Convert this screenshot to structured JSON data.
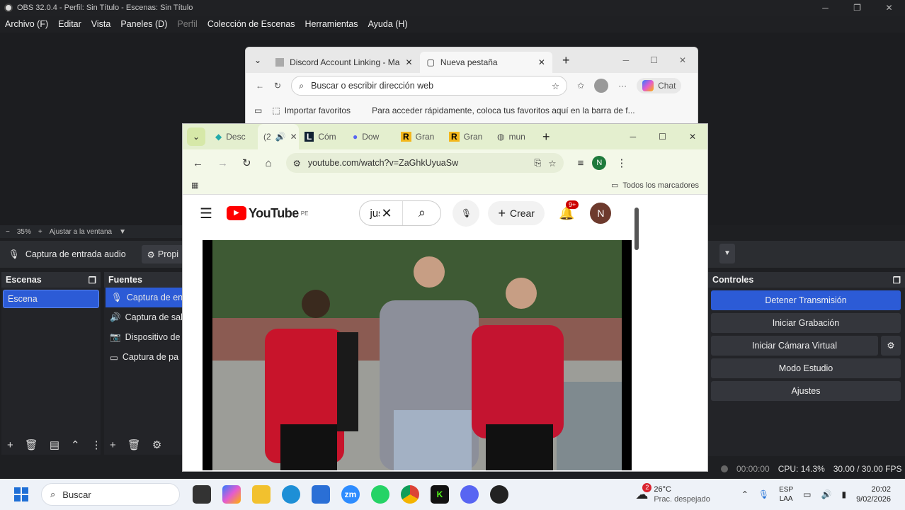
{
  "obs": {
    "title": "OBS 32.0.4 - Perfil: Sin Título - Escenas: Sin Título",
    "menu": [
      "Archivo (F)",
      "Editar",
      "Vista",
      "Paneles (D)",
      "Perfil",
      "Colección de Escenas",
      "Herramientas",
      "Ayuda (H)"
    ],
    "zoom": "35%",
    "fit_window": "Ajustar a la ventana",
    "source_toolbar_label": "Captura de entrada audio",
    "properties_label": "Propi",
    "scenes_title": "Escenas",
    "scenes": [
      "Escena"
    ],
    "sources_title": "Fuentes",
    "sources": [
      "Captura de ent",
      "Captura de sal",
      "Dispositivo de",
      "Captura de pa"
    ],
    "controls_title": "Controles",
    "controls": {
      "stop_stream": "Detener Transmisión",
      "start_record": "Iniciar Grabación",
      "virtual_cam": "Iniciar Cámara Virtual",
      "studio_mode": "Modo Estudio",
      "settings": "Ajustes"
    },
    "status": {
      "time": "00:00:00",
      "cpu": "CPU: 14.3%",
      "fps": "30.00 / 30.00 FPS"
    }
  },
  "edge": {
    "tab1": "Discord Account Linking - Ma",
    "tab2": "Nueva pestaña",
    "address_placeholder": "Buscar o escribir dirección web",
    "chat": "Chat",
    "import_fav": "Importar favoritos",
    "fav_hint": "Para acceder rápidamente, coloca tus favoritos aquí en la barra de f..."
  },
  "chrome": {
    "tabs": [
      "Desc",
      "(2",
      "Cóm",
      "Dow",
      "Gran",
      "Gran",
      "mun"
    ],
    "url": "youtube.com/watch?v=ZaGhkUyuaSw",
    "profile_letter": "N",
    "all_bookmarks": "Todos los marcadores"
  },
  "youtube": {
    "brand": "YouTube",
    "region": "PE",
    "search_value": "jus",
    "create": "Crear",
    "notif_count": "9+",
    "avatar": "N"
  },
  "taskbar": {
    "search": "Buscar",
    "weather_temp": "26°C",
    "weather_text": "Prac. despejado",
    "weather_badge": "2",
    "lang1": "ESP",
    "lang2": "LAA",
    "time": "20:02",
    "date": "9/02/2026"
  },
  "colors": {
    "obs_accent": "#2c5bd6",
    "youtube_red": "#ff0000",
    "chrome_tab_tint": "#e4efcf"
  }
}
